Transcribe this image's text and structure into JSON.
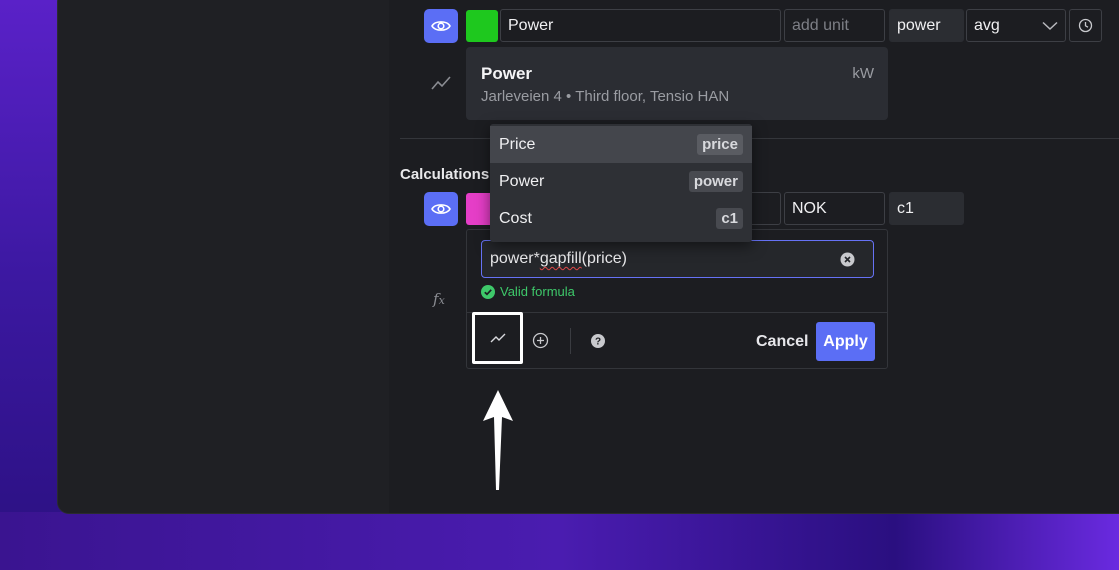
{
  "series": {
    "name_value": "Power",
    "unit_placeholder": "add unit",
    "variable": "power",
    "aggregation": "avg",
    "swatch_color": "#1ec81e"
  },
  "tooltip": {
    "title": "Power",
    "unit": "kW",
    "subtitle": "Jarleveien 4 • Third floor, Tensio HAN"
  },
  "dropdown": {
    "items": [
      {
        "label": "Price",
        "tag": "price"
      },
      {
        "label": "Power",
        "tag": "power"
      },
      {
        "label": "Cost",
        "tag": "c1"
      }
    ]
  },
  "calculations": {
    "heading": "Calculations",
    "swatch_color": "#e53ec7",
    "unit_value": "NOK",
    "variable": "c1"
  },
  "formula": {
    "value_prefix": "power*",
    "value_err": "gapfill",
    "value_suffix": "(price)",
    "status": "Valid formula",
    "cancel_label": "Cancel",
    "apply_label": "Apply"
  },
  "colors": {
    "accent": "#5b6ef5",
    "valid": "#3ec86a"
  }
}
